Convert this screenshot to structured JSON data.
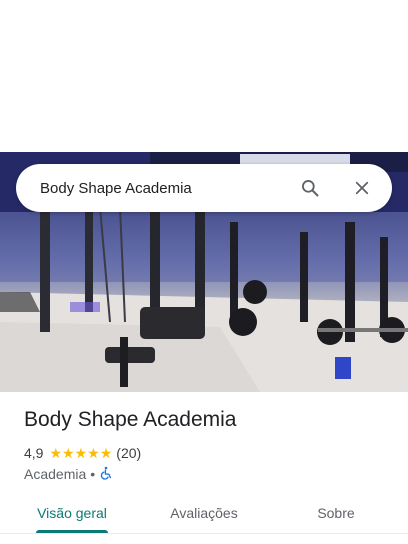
{
  "search": {
    "query": "Body Shape Academia",
    "search_icon": "search-icon",
    "close_icon": "close-icon"
  },
  "place": {
    "name": "Body Shape Academia",
    "rating": "4,9",
    "stars": 5,
    "review_count": "(20)",
    "category": "Academia",
    "separator": "•",
    "accessibility_icon": "wheelchair-icon"
  },
  "tabs": [
    {
      "label": "Visão geral",
      "active": true
    },
    {
      "label": "Avaliações",
      "active": false
    },
    {
      "label": "Sobre",
      "active": false
    }
  ],
  "colors": {
    "accent": "#0b7a75",
    "star": "#fbbc04",
    "accessibility_icon": "#1a73e8"
  }
}
